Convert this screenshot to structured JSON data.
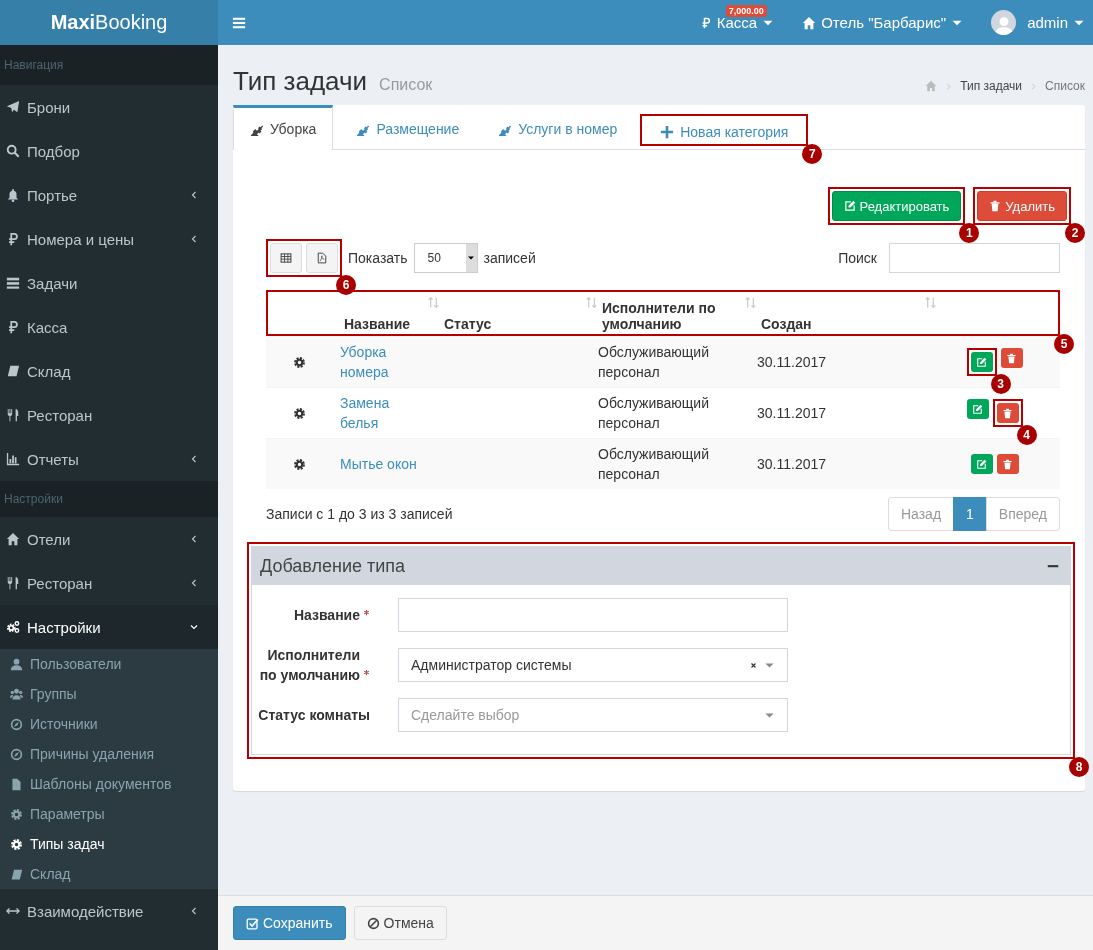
{
  "app": {
    "logo": "**Maxi**Booking"
  },
  "topbar": {
    "cash": {
      "label": "Касса",
      "badge": "7,000.00"
    },
    "hotel": {
      "label": "Отель \"Барбарис\""
    },
    "user": {
      "name": "admin"
    }
  },
  "sidebar": {
    "sections": [
      {
        "header": "Навигация",
        "items": [
          {
            "label": "Брони",
            "selected": false
          },
          {
            "label": "Подбор",
            "selected": false
          },
          {
            "label": "Портье",
            "selected": false,
            "expanded": false
          },
          {
            "label": "Номера и цены",
            "selected": false,
            "expanded": false
          },
          {
            "label": "Задачи",
            "selected": false
          },
          {
            "label": "Касса",
            "selected": false
          },
          {
            "label": "Склад",
            "selected": false
          },
          {
            "label": "Ресторан",
            "selected": false
          },
          {
            "label": "Отчеты",
            "selected": false,
            "expanded": false
          }
        ]
      },
      {
        "header": "Настройки",
        "items": [
          {
            "label": "Отели",
            "selected": false,
            "expanded": false
          },
          {
            "label": "Ресторан",
            "selected": false,
            "expanded": false
          },
          {
            "label": "Настройки",
            "selected": true,
            "expanded": true,
            "children": [
              {
                "label": "Пользователи",
                "selected": false
              },
              {
                "label": "Группы",
                "selected": false
              },
              {
                "label": "Источники",
                "selected": false
              },
              {
                "label": "Причины удаления",
                "selected": false
              },
              {
                "label": "Шаблоны документов",
                "selected": false
              },
              {
                "label": "Параметры",
                "selected": false
              },
              {
                "label": "Типы задач",
                "selected": true
              },
              {
                "label": "Склад",
                "selected": false
              }
            ]
          },
          {
            "label": "Взаимодействие",
            "selected": false,
            "expanded": false
          }
        ]
      }
    ]
  },
  "page": {
    "title": "Тип задачи",
    "subtitle": "Список",
    "breadcrumbs": [
      "Тип задачи",
      "Список"
    ]
  },
  "tabs": [
    {
      "label": "Уборка",
      "kind": "category",
      "selected": true
    },
    {
      "label": "Размещение",
      "kind": "category",
      "selected": false
    },
    {
      "label": "Услуги в номер",
      "kind": "category",
      "selected": false
    },
    {
      "label": "Новая категория",
      "kind": "add",
      "selected": false,
      "callout": "7"
    }
  ],
  "actions": [
    {
      "label": "Редактировать",
      "kind": "edit",
      "callout": "1"
    },
    {
      "label": "Удалить",
      "kind": "delete",
      "callout": "2"
    }
  ],
  "table_controls": {
    "export_callout": "6",
    "length_label": "Показать",
    "length_value": "50",
    "length_suffix": "записей",
    "search_label": "Поиск"
  },
  "table": {
    "header_callout": "5",
    "columns": [
      "Название",
      "Статус",
      "Исполнители по умолчанию",
      "Создан"
    ],
    "rows": [
      {
        "name": "Уборка номера",
        "executors": "Обслуживающий персонал",
        "created": "30.11.2017",
        "edit_callout": "3"
      },
      {
        "name": "Замена белья",
        "executors": "Обслуживающий персонал",
        "created": "30.11.2017",
        "delete_callout": "4"
      },
      {
        "name": "Мытье окон",
        "executors": "Обслуживающий персонал",
        "created": "30.11.2017"
      }
    ],
    "info": "Записи с 1 до 3 из 3 записей",
    "pagination": [
      {
        "label": "Назад",
        "disabled": true,
        "selected": false
      },
      {
        "label": "1",
        "disabled": false,
        "selected": true
      },
      {
        "label": "Вперед",
        "disabled": true,
        "selected": false
      }
    ]
  },
  "form": {
    "title": "Добавление типа",
    "callout": "8",
    "fields": [
      {
        "label": "Название",
        "required": true,
        "kind": "text"
      },
      {
        "label": "Исполнители по умолчанию",
        "required": true,
        "kind": "select",
        "value": "Администратор системы"
      },
      {
        "label": "Статус комнаты",
        "required": false,
        "kind": "select",
        "placeholder": "Сделайте выбор"
      }
    ]
  },
  "footer": {
    "buttons": [
      {
        "label": "Сохранить",
        "kind": "primary"
      },
      {
        "label": "Отмена",
        "kind": "cancel"
      }
    ]
  }
}
